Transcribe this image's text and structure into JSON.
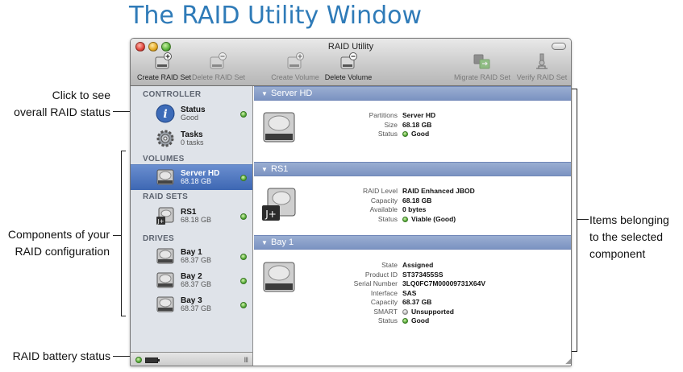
{
  "page_title": "The RAID Utility Window",
  "callouts": {
    "raid_status": [
      "Click to see",
      "overall RAID status"
    ],
    "components": [
      "Components of your",
      "RAID configuration"
    ],
    "battery": "RAID battery status",
    "items": [
      "Items belonging",
      "to the selected",
      "component"
    ]
  },
  "window": {
    "title": "RAID Utility",
    "toolbar": [
      {
        "label": "Create RAID Set",
        "icon": "create-raid-set-icon",
        "enabled": true
      },
      {
        "label": "Delete RAID Set",
        "icon": "delete-raid-set-icon",
        "enabled": false
      },
      {
        "label": "Create Volume",
        "icon": "create-volume-icon",
        "enabled": false
      },
      {
        "label": "Delete Volume",
        "icon": "delete-volume-icon",
        "enabled": true
      },
      {
        "label": "Migrate RAID Set",
        "icon": "migrate-raid-set-icon",
        "enabled": false
      },
      {
        "label": "Verify RAID Set",
        "icon": "verify-raid-set-icon",
        "enabled": false
      }
    ]
  },
  "sidebar": {
    "controller": {
      "heading": "CONTROLLER",
      "status": {
        "name": "Status",
        "value": "Good"
      },
      "tasks": {
        "name": "Tasks",
        "value": "0 tasks"
      }
    },
    "volumes": {
      "heading": "VOLUMES",
      "items": [
        {
          "name": "Server HD",
          "size": "68.18 GB"
        }
      ]
    },
    "raid_sets": {
      "heading": "RAID SETS",
      "items": [
        {
          "name": "RS1",
          "size": "68.18 GB"
        }
      ]
    },
    "drives": {
      "heading": "DRIVES",
      "items": [
        {
          "name": "Bay 1",
          "size": "68.37 GB"
        },
        {
          "name": "Bay 2",
          "size": "68.37 GB"
        },
        {
          "name": "Bay 3",
          "size": "68.37 GB"
        }
      ]
    },
    "statusbar_grip": "III"
  },
  "detail": {
    "server_hd": {
      "title": "Server HD",
      "partitions_label": "Partitions",
      "partitions": "Server HD",
      "size_label": "Size",
      "size": "68.18 GB",
      "status_label": "Status",
      "status": "Good"
    },
    "rs1": {
      "title": "RS1",
      "raid_level_label": "RAID Level",
      "raid_level": "RAID Enhanced JBOD",
      "capacity_label": "Capacity",
      "capacity": "68.18 GB",
      "available_label": "Available",
      "available": "0 bytes",
      "status_label": "Status",
      "status": "Viable (Good)"
    },
    "bay1": {
      "title": "Bay 1",
      "state_label": "State",
      "state": "Assigned",
      "product_id_label": "Product ID",
      "product_id": "ST373455SS",
      "serial_label": "Serial Number",
      "serial": "3LQ0FC7M00009731X64V",
      "interface_label": "Interface",
      "interface": "SAS",
      "capacity_label": "Capacity",
      "capacity": "68.37 GB",
      "smart_label": "SMART",
      "smart": "Unsupported",
      "status_label": "Status",
      "status": "Good"
    }
  },
  "colors": {
    "title_blue": "#2f7bb8",
    "selection_blue": "#3d67b3",
    "band_blue": "#8ba1cb",
    "status_green": "#59ad3a"
  }
}
